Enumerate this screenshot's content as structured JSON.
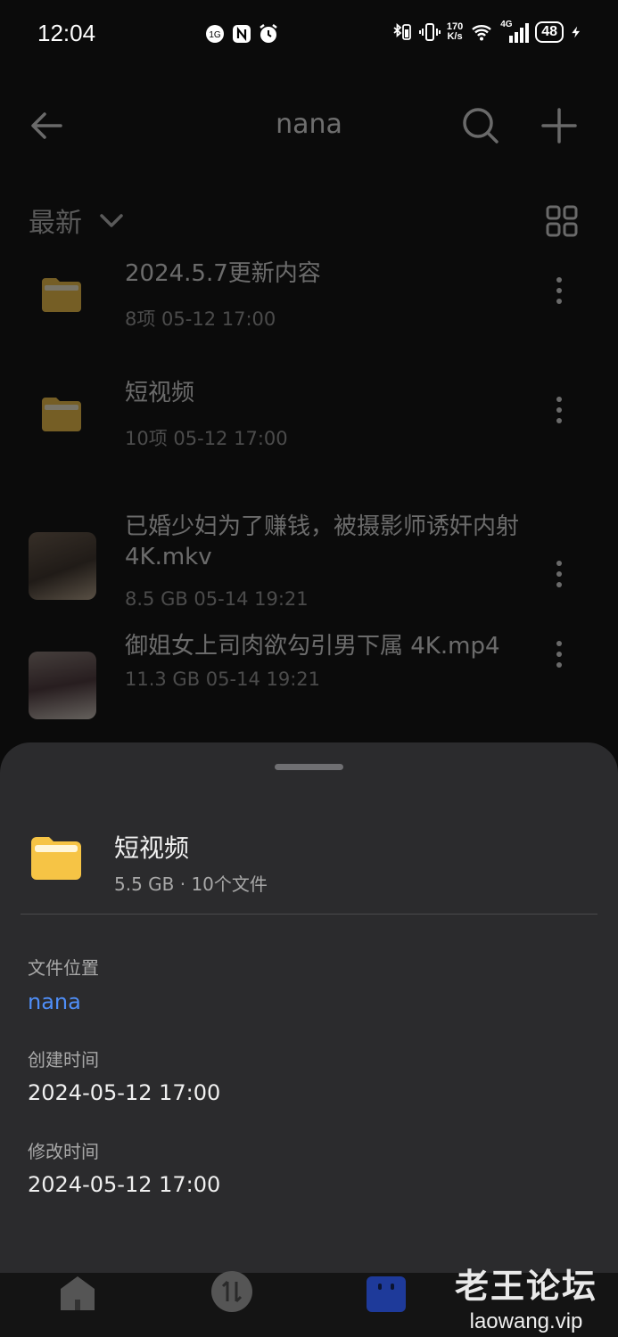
{
  "status_bar": {
    "time": "12:04",
    "net_speed_top": "170",
    "net_speed_bottom": "K/s",
    "network": "4G",
    "battery": "48"
  },
  "toolbar": {
    "title": "nana",
    "back_icon": "back-arrow-icon",
    "search_icon": "search-icon",
    "add_icon": "plus-icon"
  },
  "sort": {
    "label": "最新",
    "view_icon": "grid-view-icon"
  },
  "files": [
    {
      "type": "folder",
      "name": "2024.5.7更新内容",
      "meta": "8项  05-12 17:00"
    },
    {
      "type": "folder",
      "name": "短视频",
      "meta": "10项  05-12 17:00"
    },
    {
      "type": "video",
      "name": "已婚少妇为了赚钱，被摄影师诱奸内射 4K.mkv",
      "meta": "8.5 GB  05-14 19:21"
    },
    {
      "type": "video",
      "name": "御姐女上司肉欲勾引男下属 4K.mp4",
      "meta": "11.3 GB  05-14 19:21"
    }
  ],
  "sheet": {
    "title": "短视频",
    "meta": "5.5 GB · 10个文件",
    "location_label": "文件位置",
    "location_value": "nana",
    "created_label": "创建时间",
    "created_value": "2024-05-12 17:00",
    "modified_label": "修改时间",
    "modified_value": "2024-05-12 17:00"
  },
  "watermark": {
    "cn": "老王论坛",
    "en": "laowang.vip"
  },
  "colors": {
    "background": "#0b0b0b",
    "sheet": "#2b2b2d",
    "folder": "#f6c445",
    "link": "#4f8ef7"
  }
}
